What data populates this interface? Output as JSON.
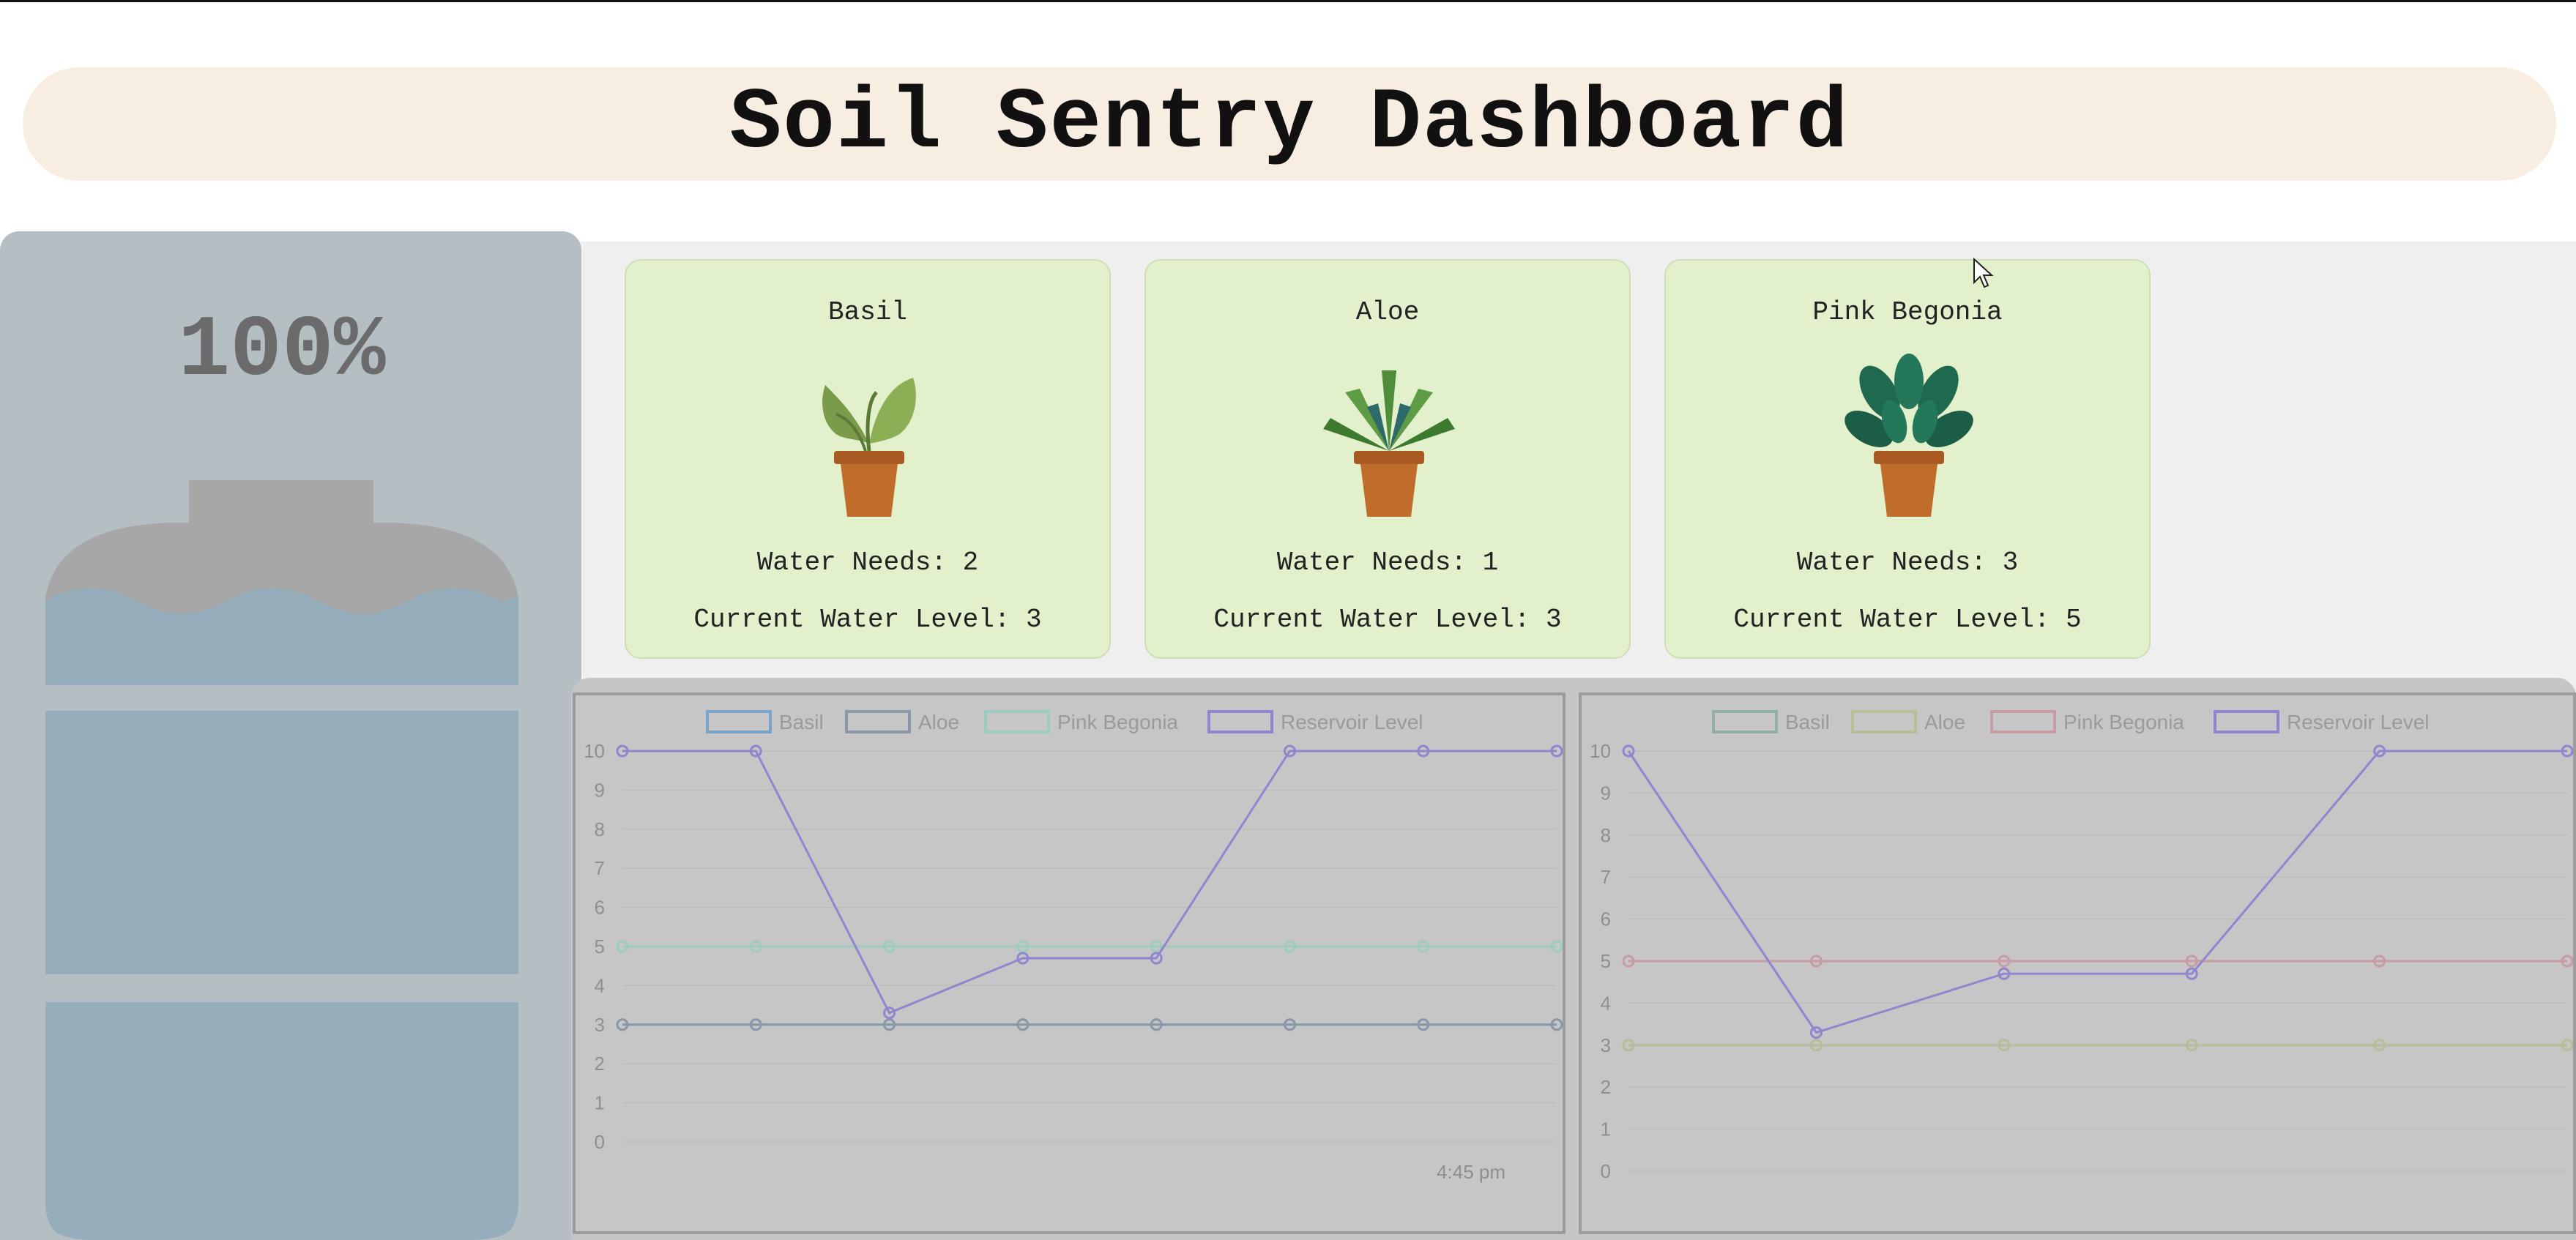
{
  "header": {
    "title": "Soil Sentry Dashboard"
  },
  "reservoir": {
    "percent_label": "100%",
    "level_fraction": 1.0,
    "icon": "water-jug-icon"
  },
  "plants": [
    {
      "name": "Basil",
      "icon": "basil-plant-icon",
      "water_needs": "Water Needs: 2",
      "current_level": "Current Water Level: 3"
    },
    {
      "name": "Aloe",
      "icon": "aloe-plant-icon",
      "water_needs": "Water Needs: 1",
      "current_level": "Current Water Level: 3"
    },
    {
      "name": "Pink Begonia",
      "icon": "begonia-plant-icon",
      "water_needs": "Water Needs: 3",
      "current_level": "Current Water Level: 5"
    }
  ],
  "chart_data": [
    {
      "type": "line",
      "legend": [
        "Basil",
        "Aloe",
        "Pink Begonia",
        "Reservoir Level"
      ],
      "legend_placement": "top",
      "ylim": [
        0,
        10
      ],
      "yticks": [
        "10",
        "9",
        "8",
        "7",
        "6",
        "5",
        "4",
        "3",
        "2",
        "1",
        "0"
      ],
      "xtick_labels": [
        "4:45 pm"
      ],
      "series": [
        {
          "name": "Basil",
          "color": "#7aa3c8",
          "values": [
            3,
            3,
            3,
            3,
            3,
            3,
            3,
            3
          ]
        },
        {
          "name": "Aloe",
          "color": "#8a98a8",
          "values": [
            3,
            3,
            3,
            3,
            3,
            3,
            3,
            3
          ]
        },
        {
          "name": "Pink Begonia",
          "color": "#9ccbc0",
          "values": [
            5,
            5,
            5,
            5,
            5,
            5,
            5,
            5
          ]
        },
        {
          "name": "Reservoir Level",
          "color": "#8f86cf",
          "values": [
            10,
            10,
            3.3,
            4.7,
            4.7,
            10,
            10,
            10
          ]
        }
      ]
    },
    {
      "type": "line",
      "legend": [
        "Basil",
        "Aloe",
        "Pink Begonia",
        "Reservoir Level"
      ],
      "legend_placement": "top",
      "ylim": [
        0,
        10
      ],
      "yticks": [
        "10",
        "9",
        "8",
        "7",
        "6",
        "5",
        "4",
        "3",
        "2",
        "1",
        "0"
      ],
      "xtick_labels": [],
      "series": [
        {
          "name": "Basil",
          "color": "#8fb0a3",
          "values": [
            3,
            3,
            3,
            3,
            3,
            3
          ]
        },
        {
          "name": "Aloe",
          "color": "#b7bf9a",
          "values": [
            3,
            3,
            3,
            3,
            3,
            3
          ]
        },
        {
          "name": "Pink Begonia",
          "color": "#c79aa4",
          "values": [
            5,
            5,
            5,
            5,
            5,
            5
          ]
        },
        {
          "name": "Reservoir Level",
          "color": "#8f86cf",
          "values": [
            10,
            3.3,
            4.7,
            4.7,
            10,
            10
          ]
        }
      ]
    }
  ]
}
